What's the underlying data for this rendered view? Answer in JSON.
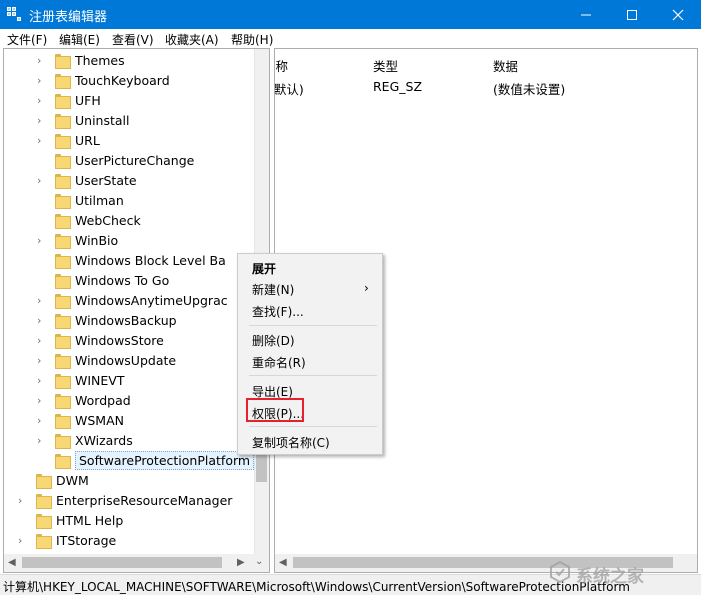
{
  "window": {
    "title": "注册表编辑器",
    "title_bar_color": "#0078d7",
    "icons": {
      "app": "registry-icon",
      "minimize": "minimize-icon",
      "maximize": "maximize-icon",
      "close": "close-icon"
    }
  },
  "menu": {
    "items": [
      {
        "label": "文件(F)"
      },
      {
        "label": "编辑(E)"
      },
      {
        "label": "查看(V)"
      },
      {
        "label": "收藏夹(A)"
      },
      {
        "label": "帮助(H)"
      }
    ]
  },
  "tree": {
    "items": [
      {
        "label": "Themes",
        "expandable": true
      },
      {
        "label": "TouchKeyboard",
        "expandable": true
      },
      {
        "label": "UFH",
        "expandable": true
      },
      {
        "label": "Uninstall",
        "expandable": true
      },
      {
        "label": "URL",
        "expandable": true
      },
      {
        "label": "UserPictureChange",
        "expandable": false
      },
      {
        "label": "UserState",
        "expandable": true
      },
      {
        "label": "Utilman",
        "expandable": false
      },
      {
        "label": "WebCheck",
        "expandable": false
      },
      {
        "label": "WinBio",
        "expandable": true
      },
      {
        "label": "Windows Block Level Ba",
        "expandable": false
      },
      {
        "label": "Windows To Go",
        "expandable": false
      },
      {
        "label": "WindowsAnytimeUpgrac",
        "expandable": true
      },
      {
        "label": "WindowsBackup",
        "expandable": true
      },
      {
        "label": "WindowsStore",
        "expandable": true
      },
      {
        "label": "WindowsUpdate",
        "expandable": true
      },
      {
        "label": "WINEVT",
        "expandable": true
      },
      {
        "label": "Wordpad",
        "expandable": true
      },
      {
        "label": "WSMAN",
        "expandable": true
      },
      {
        "label": "XWizards",
        "expandable": true
      },
      {
        "label": "SoftwareProtectionPlatform",
        "expandable": false,
        "selected": true
      },
      {
        "label": "DWM",
        "expandable": false
      },
      {
        "label": "EnterpriseResourceManager",
        "expandable": true
      },
      {
        "label": "HTML Help",
        "expandable": false
      },
      {
        "label": "ITStorage",
        "expandable": true
      }
    ]
  },
  "list": {
    "columns": [
      {
        "label": "名称"
      },
      {
        "label": "类型"
      },
      {
        "label": "数据"
      }
    ],
    "rows": [
      {
        "name": "(默认)",
        "type": "REG_SZ",
        "data": "(数值未设置)"
      }
    ]
  },
  "context_menu": {
    "items": [
      {
        "label": "展开",
        "bold": true
      },
      {
        "label": "新建(N)",
        "submenu": true
      },
      {
        "label": "查找(F)..."
      },
      {
        "label": "删除(D)"
      },
      {
        "label": "重命名(R)"
      },
      {
        "label": "导出(E)"
      },
      {
        "label": "权限(P)...",
        "highlighted": true
      },
      {
        "label": "复制项名称(C)"
      }
    ],
    "highlight_color": "#e5212d"
  },
  "status": {
    "path": "计算机\\HKEY_LOCAL_MACHINE\\SOFTWARE\\Microsoft\\Windows\\CurrentVersion\\SoftwareProtectionPlatform"
  },
  "watermark": {
    "text": "系统之家"
  }
}
